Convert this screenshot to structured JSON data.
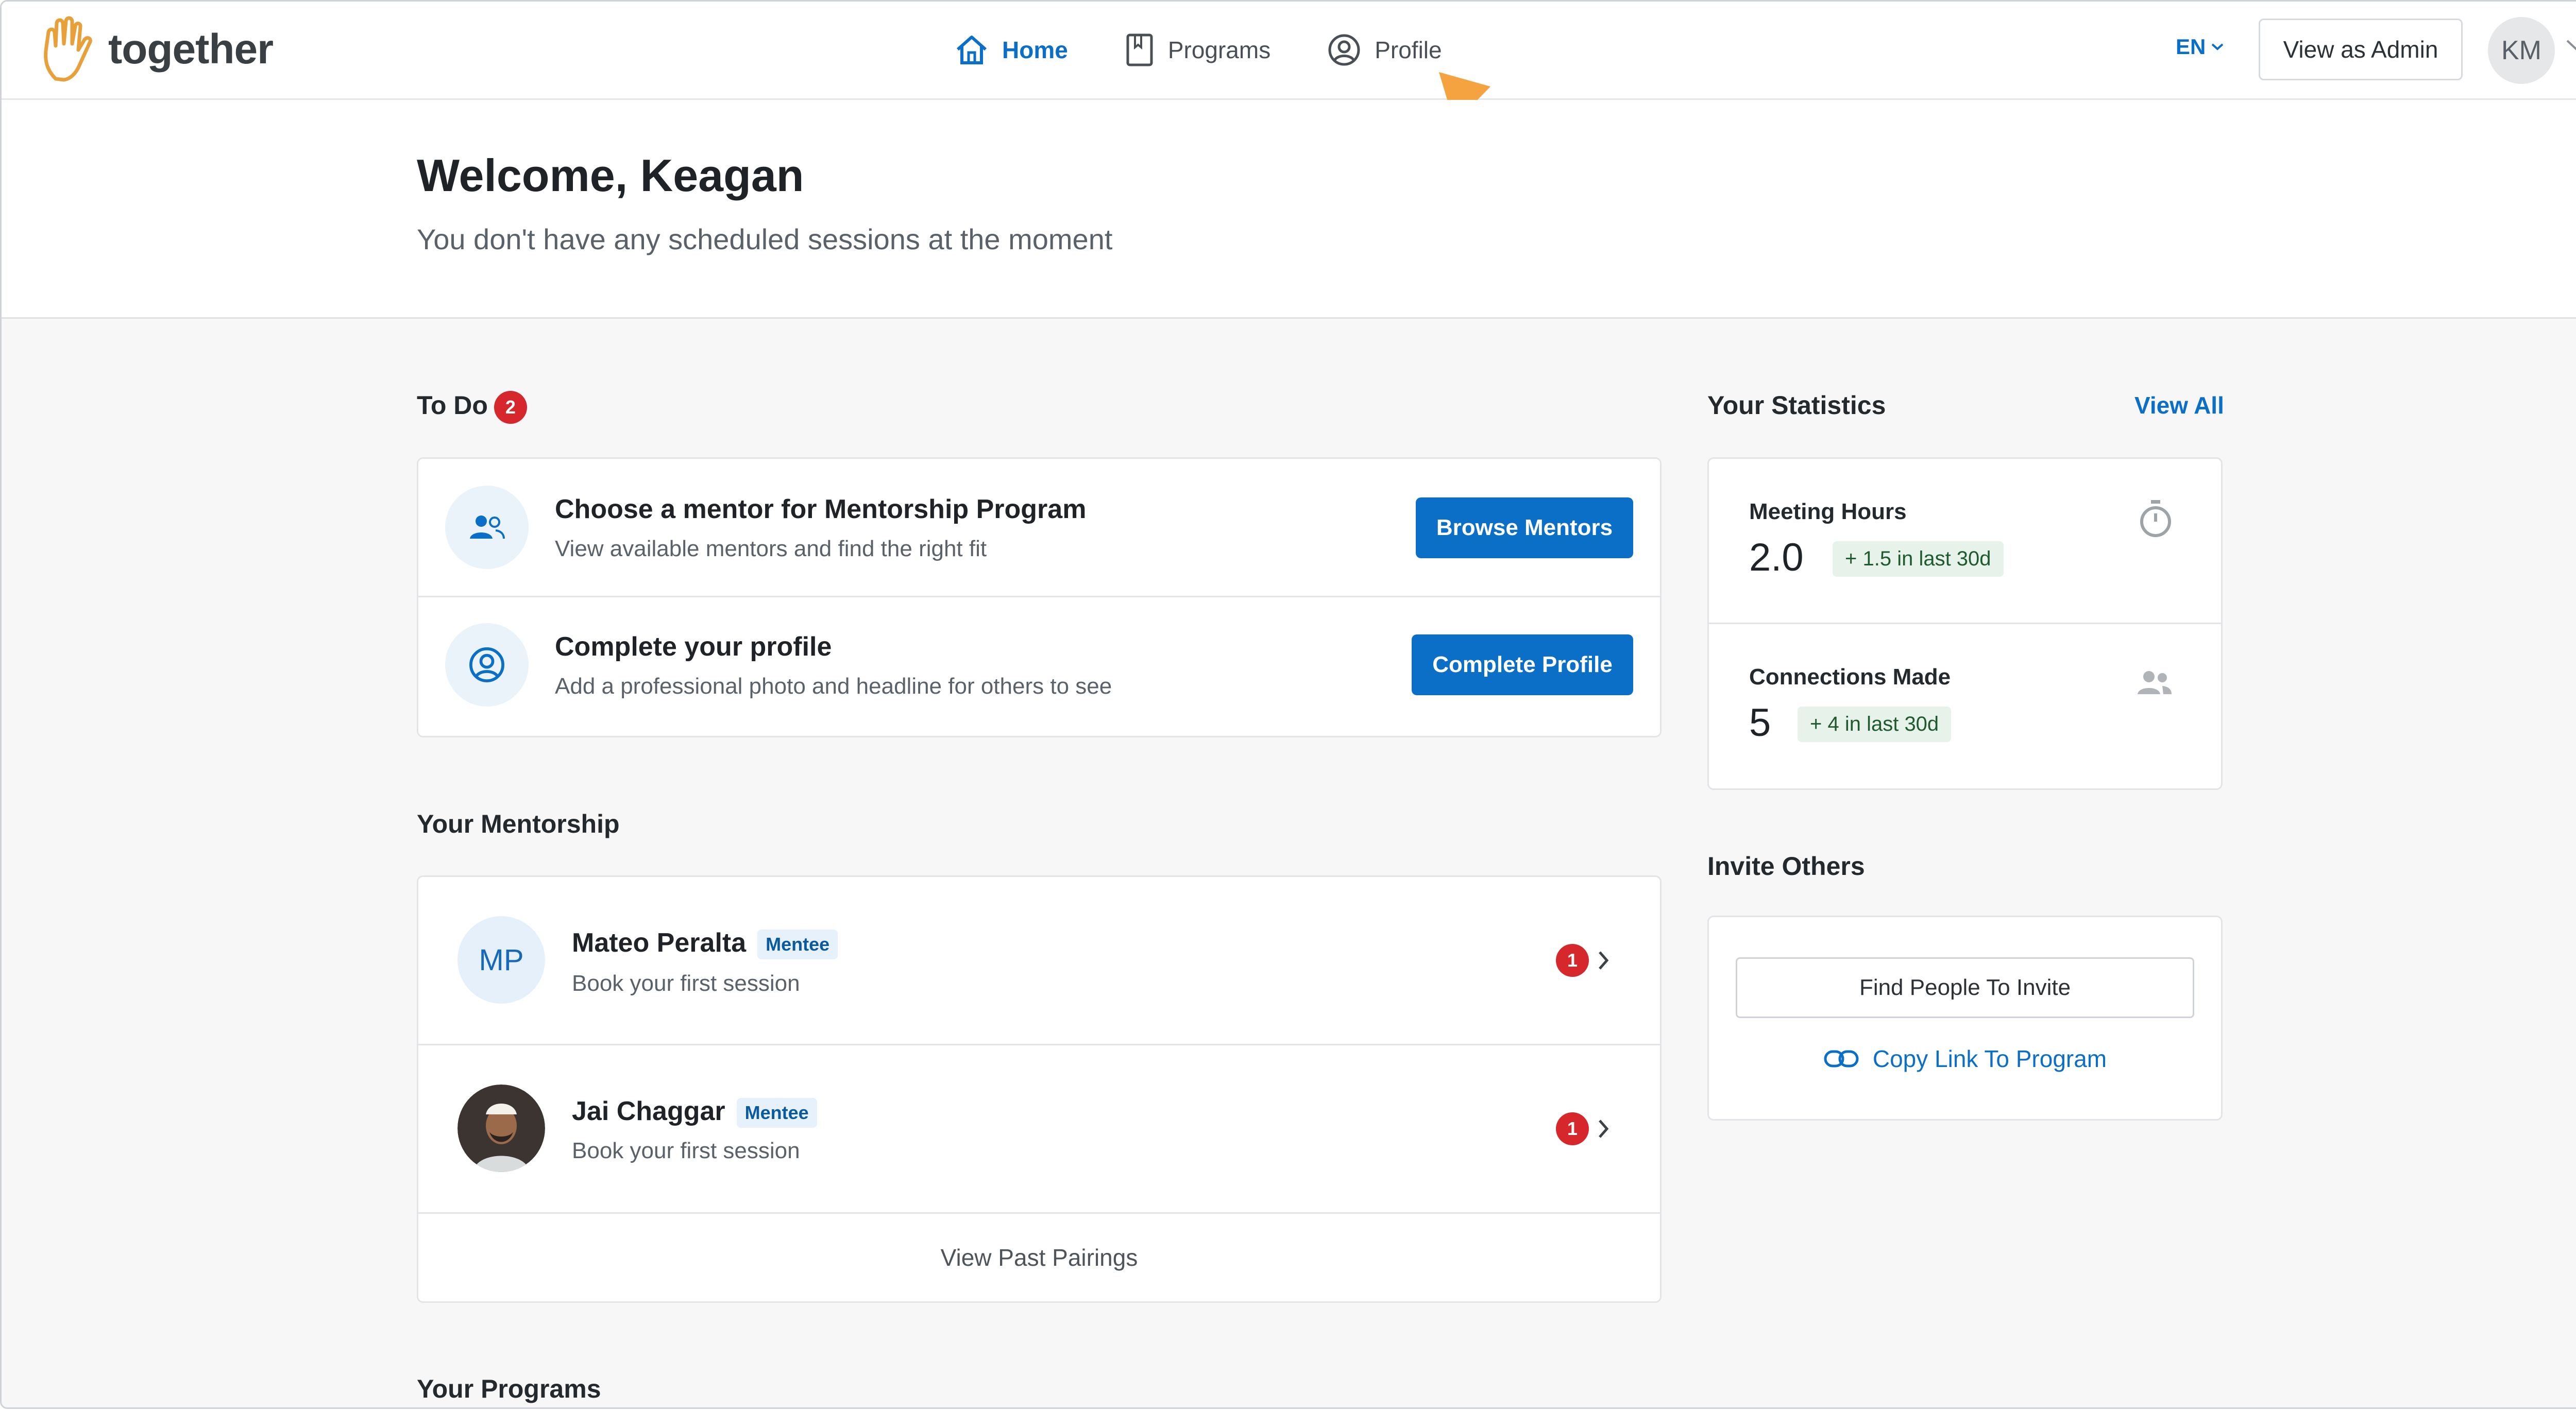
{
  "brand": {
    "name": "together"
  },
  "nav": [
    {
      "label": "Home",
      "icon": "home-icon",
      "active": true
    },
    {
      "label": "Programs",
      "icon": "book-icon",
      "active": false
    },
    {
      "label": "Profile",
      "icon": "profile-icon",
      "active": false
    }
  ],
  "header": {
    "language": "EN",
    "view_as_admin": "View as Admin",
    "avatar_initials": "KM"
  },
  "hero": {
    "welcome": "Welcome, Keagan",
    "subtitle": "You don't have any scheduled sessions at the moment"
  },
  "todo": {
    "title": "To Do",
    "count": "2",
    "items": [
      {
        "title": "Choose a mentor for Mentorship Program",
        "subtitle": "View available mentors and find the right fit",
        "button": "Browse Mentors",
        "icon": "people-icon"
      },
      {
        "title": "Complete your profile",
        "subtitle": "Add a professional photo and headline for others to see",
        "button": "Complete Profile",
        "icon": "profile-icon"
      }
    ]
  },
  "mentorship": {
    "title": "Your Mentorship",
    "pairs": [
      {
        "initials": "MP",
        "name": "Mateo Peralta",
        "role": "Mentee",
        "status": "Book your first session",
        "unread": "1"
      },
      {
        "initials": "",
        "name": "Jai Chaggar",
        "role": "Mentee",
        "status": "Book your first session",
        "unread": "1"
      }
    ],
    "view_past": "View Past Pairings"
  },
  "programs": {
    "title": "Your Programs"
  },
  "statistics": {
    "title": "Your Statistics",
    "view_all": "View All",
    "items": [
      {
        "label": "Meeting Hours",
        "value": "2.0",
        "delta": "+ 1.5 in last 30d",
        "icon": "stopwatch-icon"
      },
      {
        "label": "Connections Made",
        "value": "5",
        "delta": "+ 4 in last 30d",
        "icon": "people-icon"
      }
    ]
  },
  "invite": {
    "title": "Invite Others",
    "find_button": "Find People To Invite",
    "copy_link": "Copy Link To Program"
  },
  "colors": {
    "accent": "#0b6fc8",
    "badge": "#d6282c",
    "arrow": "#f4a340",
    "logo": "#e8a13a"
  }
}
